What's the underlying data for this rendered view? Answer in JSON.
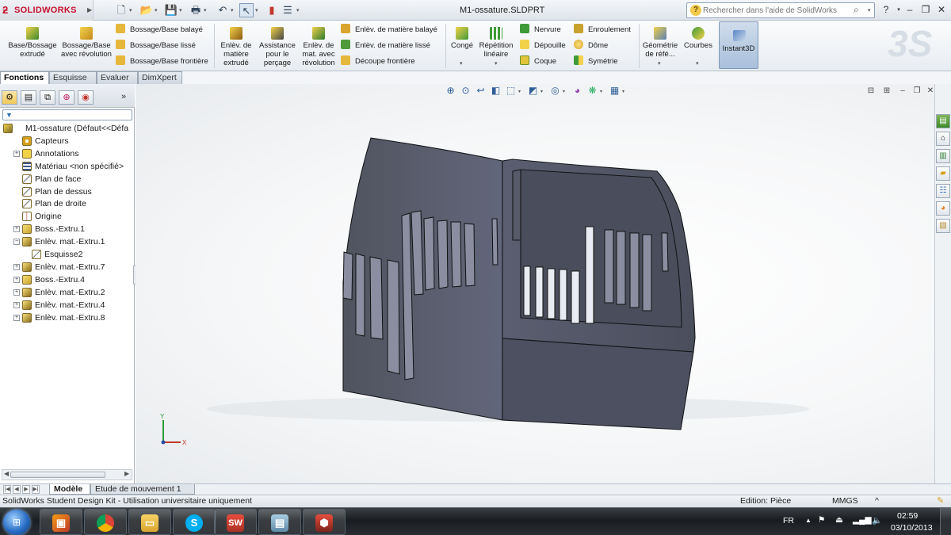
{
  "app": {
    "brand": "SOLIDWORKS",
    "document_title": "M1-ossature.SLDPRT"
  },
  "help_search": {
    "placeholder": "Rechercher dans l'aide de SolidWorks"
  },
  "ribbon": {
    "base_extrude": "Base/Bossage extrudé",
    "base_revolve": "Bossage/Base avec révolution",
    "swept_boss": "Bossage/Base balayé",
    "lofted_boss": "Bossage/Base lissé",
    "boundary_boss": "Bossage/Base frontière",
    "extruded_cut": "Enlèv. de matière extrudé",
    "hole_wizard": "Assistance pour le perçage",
    "revolved_cut": "Enlèv. de mat. avec révolution",
    "swept_cut": "Enlèv. de matière balayé",
    "lofted_cut": "Enlèv. de matière lissé",
    "boundary_cut": "Découpe frontière",
    "fillet": "Congé",
    "linear_pattern": "Répétition linéaire",
    "rib": "Nervure",
    "draft": "Dépouille",
    "shell": "Coque",
    "wrap": "Enroulement",
    "dome": "Dôme",
    "mirror": "Symétrie",
    "ref_geometry": "Géométrie de réfé...",
    "curves": "Courbes",
    "instant3d": "Instant3D"
  },
  "command_tabs": [
    "Fonctions",
    "Esquisse",
    "Evaluer",
    "DimXpert"
  ],
  "feature_tree": [
    {
      "label": "M1-ossature  (Défaut<<Défa",
      "indent": 0,
      "expander": "",
      "icon": "part-icon"
    },
    {
      "label": "Capteurs",
      "indent": 1,
      "expander": "",
      "icon": "sensor-icon"
    },
    {
      "label": "Annotations",
      "indent": 1,
      "expander": "+",
      "icon": "annotation-icon"
    },
    {
      "label": "Matériau <non spécifié>",
      "indent": 1,
      "expander": "",
      "icon": "material-icon"
    },
    {
      "label": "Plan de face",
      "indent": 1,
      "expander": "",
      "icon": "plane-icon"
    },
    {
      "label": "Plan de dessus",
      "indent": 1,
      "expander": "",
      "icon": "plane-icon"
    },
    {
      "label": "Plan de droite",
      "indent": 1,
      "expander": "",
      "icon": "plane-icon"
    },
    {
      "label": "Origine",
      "indent": 1,
      "expander": "",
      "icon": "origin-icon"
    },
    {
      "label": "Boss.-Extru.1",
      "indent": 1,
      "expander": "+",
      "icon": "extrude-icon"
    },
    {
      "label": "Enlèv. mat.-Extru.1",
      "indent": 1,
      "expander": "−",
      "icon": "cut-icon"
    },
    {
      "label": "Esquisse2",
      "indent": 2,
      "expander": "",
      "icon": "sketch-icon"
    },
    {
      "label": "Enlèv. mat.-Extru.7",
      "indent": 1,
      "expander": "+",
      "icon": "cut-icon"
    },
    {
      "label": "Boss.-Extru.4",
      "indent": 1,
      "expander": "+",
      "icon": "extrude-icon"
    },
    {
      "label": "Enlèv. mat.-Extru.2",
      "indent": 1,
      "expander": "+",
      "icon": "cut-icon"
    },
    {
      "label": "Enlèv. mat.-Extru.4",
      "indent": 1,
      "expander": "+",
      "icon": "cut-icon"
    },
    {
      "label": "Enlèv. mat.-Extru.8",
      "indent": 1,
      "expander": "+",
      "icon": "cut-icon"
    }
  ],
  "triad": {
    "x_label": "X",
    "y_label": "Y"
  },
  "bottom_tabs": [
    "Modèle",
    "Etude de mouvement 1"
  ],
  "status": {
    "license": "SolidWorks Student Design Kit - Utilisation universitaire uniquement",
    "mode": "Edition: Pièce",
    "units": "MMGS",
    "units_arrow": "^"
  },
  "taskbar": {
    "language": "FR",
    "time": "02:59",
    "date": "03/10/2013"
  },
  "colors": {
    "brand": "#c8102e",
    "model_face": "#5a5e6b",
    "model_edge": "#15161a",
    "accent": "#2a6fc6"
  }
}
